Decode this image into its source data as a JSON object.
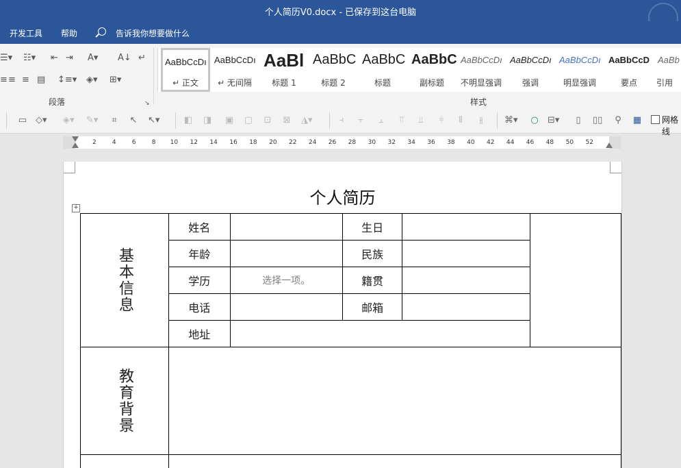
{
  "window": {
    "title": "个人简历V0.docx - 已保存到这台电脑"
  },
  "menu": {
    "items": [
      "开发工具",
      "帮助"
    ],
    "search_text": "告诉我你想要做什么"
  },
  "ribbon": {
    "paragraph_group_label": "段落",
    "styles_group_label": "样式",
    "styles": [
      {
        "sample": "AaBbCcDı",
        "name": "↵ 正文"
      },
      {
        "sample": "AaBbCcDı",
        "name": "↵ 无间隔"
      },
      {
        "sample": "AaBl",
        "name": "标题 1"
      },
      {
        "sample": "AaBbC",
        "name": "标题 2"
      },
      {
        "sample": "AaBbC",
        "name": "标题"
      },
      {
        "sample": "AaBbC",
        "name": "副标题"
      },
      {
        "sample": "AaBbCcDı",
        "name": "不明显强调"
      },
      {
        "sample": "AaBbCcDı",
        "name": "强调"
      },
      {
        "sample": "AaBbCcDı",
        "name": "明显强调"
      },
      {
        "sample": "AaBbCcD",
        "name": "要点"
      },
      {
        "sample": "AaBb",
        "name": "引用"
      }
    ]
  },
  "toolbar2": {
    "gridlines_label": "网格线"
  },
  "ruler": {
    "ticks": [
      "2",
      "4",
      "6",
      "8",
      "10",
      "12",
      "14",
      "16",
      "18",
      "20",
      "22",
      "24",
      "26",
      "28",
      "30",
      "32",
      "34",
      "36",
      "38",
      "40",
      "42",
      "44",
      "46",
      "48",
      "50",
      "52"
    ]
  },
  "document": {
    "title": "个人简历",
    "section_basic": "基本信息",
    "section_edu": "教育背景",
    "label_name": "姓名",
    "label_birthday": "生日",
    "label_age": "年龄",
    "label_ethnicity": "民族",
    "label_education": "学历",
    "education_placeholder": "选择一项。",
    "label_origin": "籍贯",
    "label_phone": "电话",
    "label_email": "邮箱",
    "label_address": "地址"
  }
}
